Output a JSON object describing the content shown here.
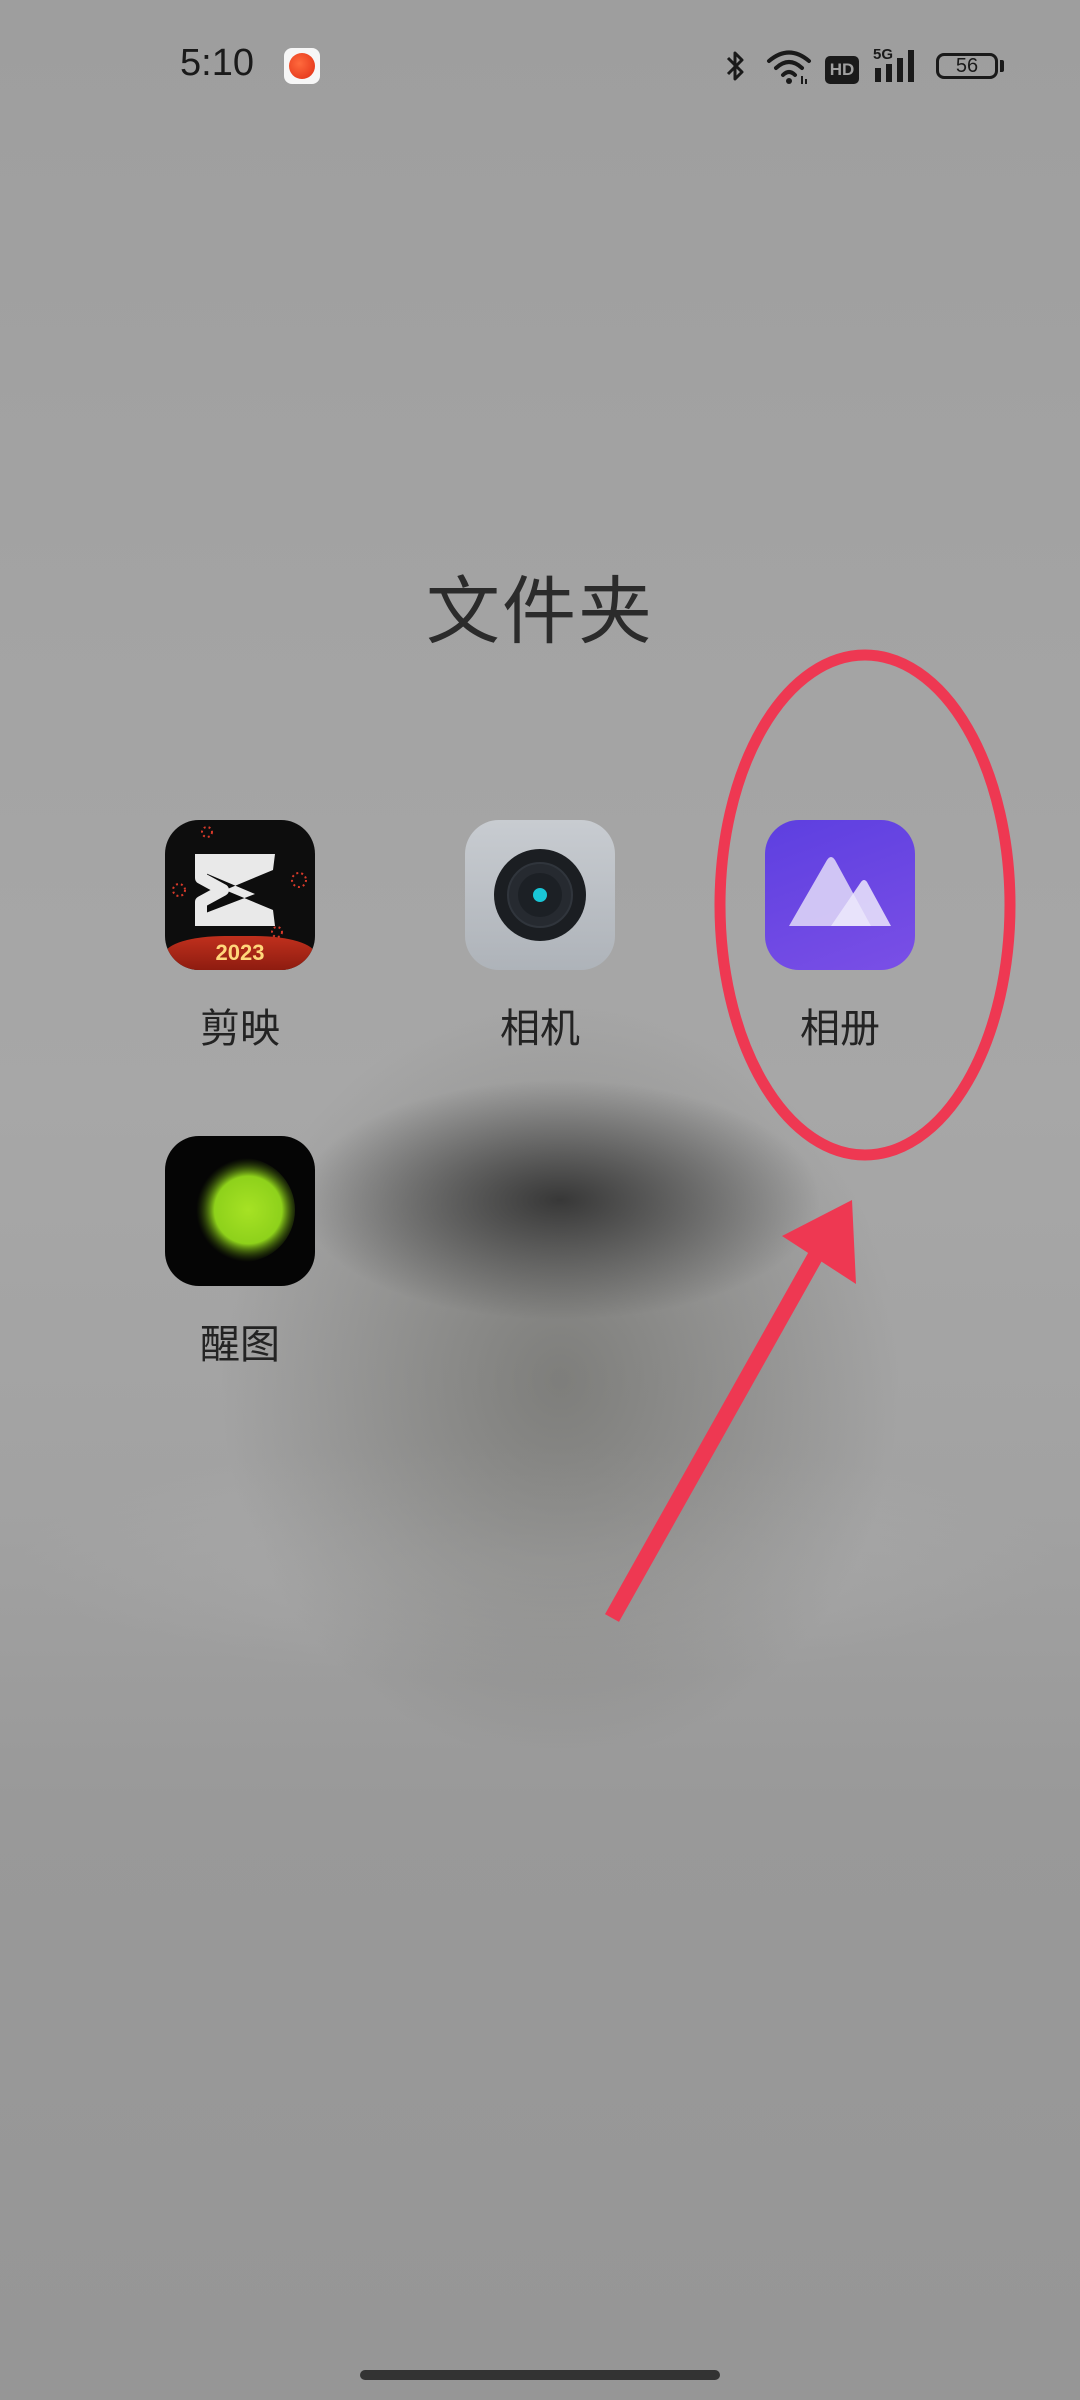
{
  "status_bar": {
    "time": "5:10",
    "battery": "56",
    "network": "5G",
    "hd_label": "HD",
    "notification_app_icon": "red-app-icon"
  },
  "folder": {
    "title": "文件夹"
  },
  "apps": [
    {
      "id": "jianying",
      "label": "剪映",
      "badge_text": "2023",
      "icon": "capcut-icon"
    },
    {
      "id": "camera",
      "label": "相机",
      "icon": "camera-icon"
    },
    {
      "id": "album",
      "label": "相册",
      "icon": "photos-icon"
    },
    {
      "id": "xingtu",
      "label": "醒图",
      "icon": "xingtu-icon"
    }
  ],
  "colors": {
    "annotation_red": "#ee3852",
    "album_purple": "#6a48e3",
    "camera_lens_cyan": "#19c6d6",
    "xingtu_green": "#8ed11b"
  }
}
